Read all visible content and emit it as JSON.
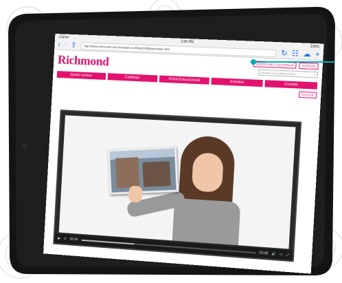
{
  "statusbar": {
    "carrier": "Carrier",
    "time": "2:05 PM",
    "battery": "100%"
  },
  "browser": {
    "url": "http://www.richmond.com.br/estatic.m2/hotp/1080panoramic.htm",
    "back_icon": "chevron-left-icon",
    "forward_icon": "chevron-right-icon",
    "share_icon": "share-icon",
    "reload_icon": "reload-icon",
    "bookmarks_icon": "book-icon",
    "cloud_icon": "cloud-icon",
    "newtab_icon": "plus-icon"
  },
  "site": {
    "logo": "Richmond",
    "header_buttons": [
      "QUERO ME CADASTRAR",
      "ENTRAR"
    ],
    "search_placeholder": "Escolha uma palavra-chave",
    "nav": [
      "Quem somos",
      "Catálogo",
      "Portal Educacional",
      "Eventos",
      "Contato"
    ],
    "volver": "VOLTAR"
  },
  "video": {
    "time_current": "00:34",
    "time_total": "03:48",
    "progress": 0.31
  },
  "colors": {
    "brand": "#e2136f",
    "accent": "#00adb5",
    "ios_blue": "#1a73e8"
  }
}
